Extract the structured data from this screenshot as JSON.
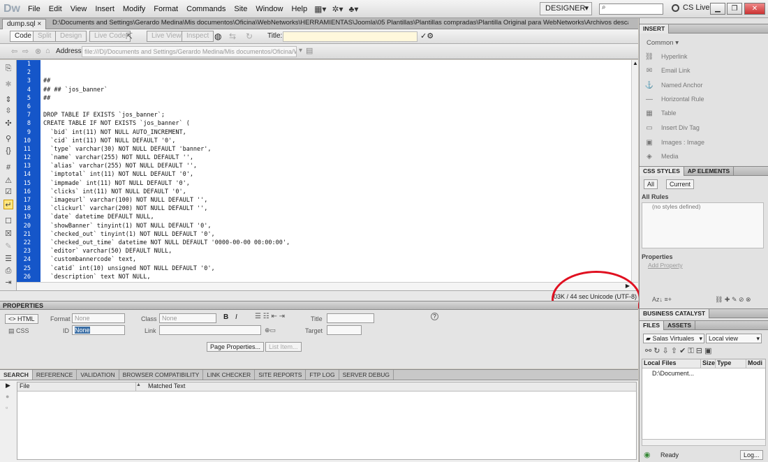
{
  "app": {
    "logo": "Dw",
    "menus": [
      "File",
      "Edit",
      "View",
      "Insert",
      "Modify",
      "Format",
      "Commands",
      "Site",
      "Window",
      "Help"
    ],
    "workspace": "DESIGNER",
    "cslive": "CS Live"
  },
  "document": {
    "tab": "dump.sql",
    "path": "D:\\Documents and Settings\\Gerardo Medina\\Mis documentos\\Oficina\\WebNetworks\\HERRAMIENTAS\\Joomla\\05 Plantillas\\Plantillas compradas\\Plantilla Original para WebNetworks\\Archivos descargados\\tmp\\sources\\dump.sql",
    "views": [
      "Code",
      "Split",
      "Design",
      "Live Code",
      "Live View",
      "Inspect"
    ],
    "title_label": "Title:",
    "address_label": "Address:",
    "address_value": "file:///D|/Documents and Settings/Gerardo Medina/Mis documentos/Oficina/We"
  },
  "code": {
    "line_numbers": [
      "1",
      "2",
      "3",
      "4",
      "5",
      "6",
      "7",
      "8",
      "9",
      "10",
      "11",
      "12",
      "13",
      "14",
      "15",
      "16",
      "17",
      "18",
      "19",
      "20",
      "21",
      "22",
      "23",
      "24",
      "25",
      "26"
    ],
    "lines": [
      "",
      "",
      "##",
      "## ## `jos_banner`",
      "##",
      "",
      "DROP TABLE IF EXISTS `jos_banner`;",
      "CREATE TABLE IF NOT EXISTS `jos_banner` (",
      "  `bid` int(11) NOT NULL AUTO_INCREMENT,",
      "  `cid` int(11) NOT NULL DEFAULT '0',",
      "  `type` varchar(30) NOT NULL DEFAULT 'banner',",
      "  `name` varchar(255) NOT NULL DEFAULT '',",
      "  `alias` varchar(255) NOT NULL DEFAULT '',",
      "  `imptotal` int(11) NOT NULL DEFAULT '0',",
      "  `impmade` int(11) NOT NULL DEFAULT '0',",
      "  `clicks` int(11) NOT NULL DEFAULT '0',",
      "  `imageurl` varchar(100) NOT NULL DEFAULT '',",
      "  `clickurl` varchar(200) NOT NULL DEFAULT '',",
      "  `date` datetime DEFAULT NULL,",
      "  `showBanner` tinyint(1) NOT NULL DEFAULT '0',",
      "  `checked_out` tinyint(1) NOT NULL DEFAULT '0',",
      "  `checked_out_time` datetime NOT NULL DEFAULT '0000-00-00 00:00:00',",
      "  `editor` varchar(50) DEFAULT NULL,",
      "  `custombannercode` text,",
      "  `catid` int(10) unsigned NOT NULL DEFAULT '0',",
      "  `description` text NOT NULL,"
    ]
  },
  "status": {
    "size": "03K / 44 sec",
    "encoding": "Unicode (UTF-8)"
  },
  "properties": {
    "header": "PROPERTIES",
    "html_btn": "HTML",
    "css_btn": "CSS",
    "format_label": "Format",
    "format_value": "None",
    "class_label": "Class",
    "class_value": "None",
    "id_label": "ID",
    "id_value": "None",
    "link_label": "Link",
    "title_label": "Title",
    "target_label": "Target",
    "bold": "B",
    "italic": "I",
    "page_props": "Page Properties...",
    "list_item": "List Item..."
  },
  "bottom": {
    "tabs": [
      "SEARCH",
      "REFERENCE",
      "VALIDATION",
      "BROWSER COMPATIBILITY",
      "LINK CHECKER",
      "SITE REPORTS",
      "FTP LOG",
      "SERVER DEBUG"
    ],
    "col_file": "File",
    "col_matched": "Matched Text"
  },
  "insert": {
    "header": "INSERT",
    "category": "Common",
    "items": [
      "Hyperlink",
      "Email Link",
      "Named Anchor",
      "Horizontal Rule",
      "Table",
      "Insert Div Tag",
      "Images : Image",
      "Media"
    ]
  },
  "css": {
    "tab_styles": "CSS STYLES",
    "tab_ap": "AP ELEMENTS",
    "btn_all": "All",
    "btn_current": "Current",
    "all_rules": "All Rules",
    "no_styles": "(no styles defined)",
    "properties": "Properties",
    "add_property": "Add Property"
  },
  "bc": {
    "header": "BUSINESS CATALYST"
  },
  "files": {
    "tab_files": "FILES",
    "tab_assets": "ASSETS",
    "site": "Salas Virtuales",
    "view": "Local view",
    "col_local": "Local Files",
    "col_size": "Size",
    "col_type": "Type",
    "col_mod": "Modi",
    "row": "D:\\Document...",
    "status": "Ready",
    "log_btn": "Log..."
  }
}
